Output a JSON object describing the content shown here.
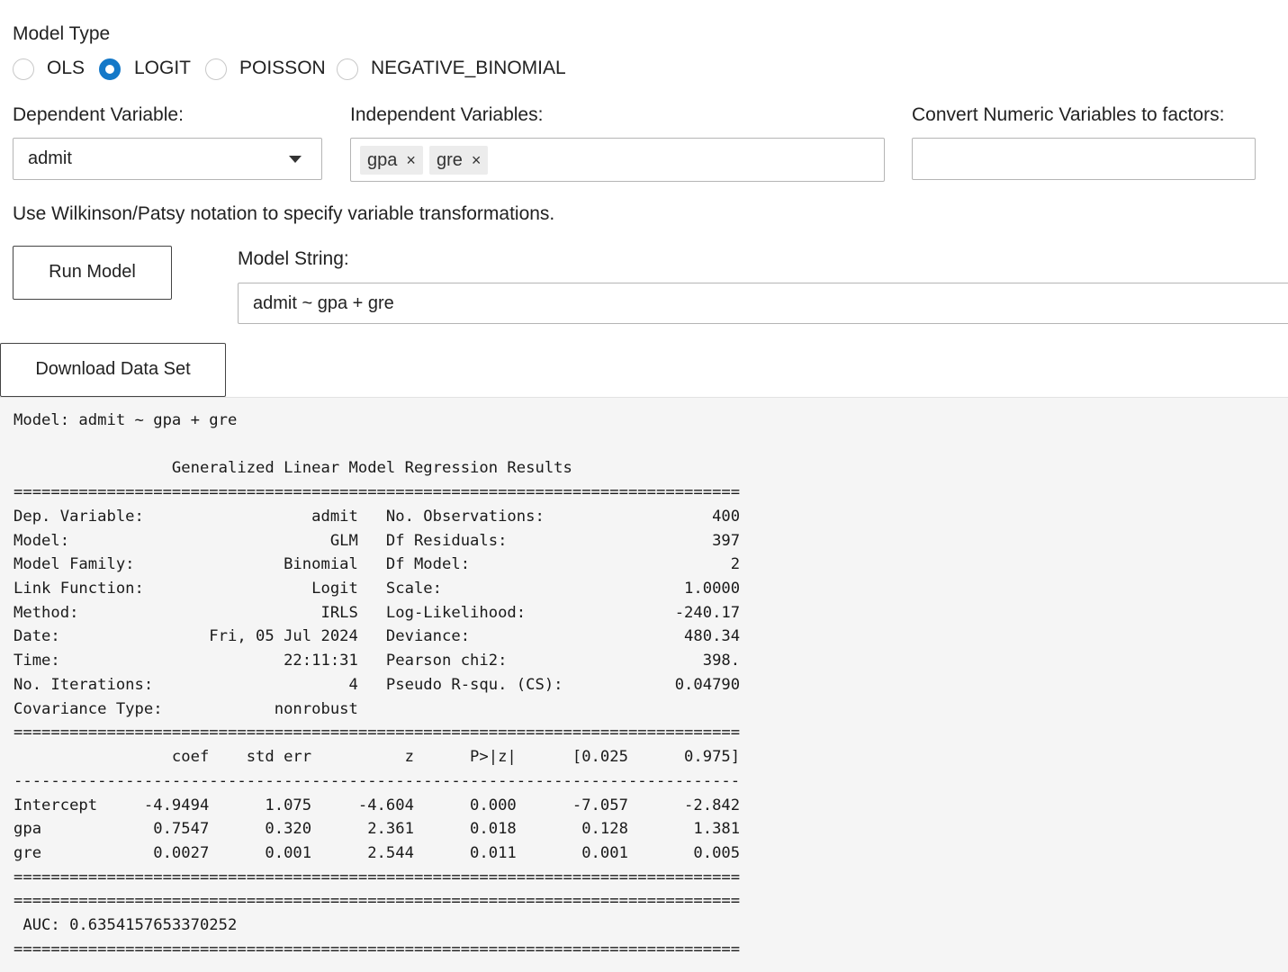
{
  "model_type": {
    "label": "Model Type",
    "options": [
      {
        "label": "OLS",
        "checked": false
      },
      {
        "label": "LOGIT",
        "checked": true
      },
      {
        "label": "POISSON",
        "checked": false
      },
      {
        "label": "NEGATIVE_BINOMIAL",
        "checked": false
      }
    ]
  },
  "dependent": {
    "label": "Dependent Variable:",
    "value": "admit"
  },
  "independent": {
    "label": "Independent Variables:",
    "chips": [
      "gpa",
      "gre"
    ],
    "remove_glyph": "×"
  },
  "convert": {
    "label": "Convert Numeric Variables to factors:",
    "value": ""
  },
  "notation_hint": "Use Wilkinson/Patsy notation to specify variable transformations.",
  "run_button": "Run Model",
  "model_string": {
    "label": "Model String:",
    "value": "admit ~ gpa + gre"
  },
  "download_button": "Download Data Set",
  "output": {
    "lines": [
      "Model: admit ~ gpa + gre",
      "",
      "                 Generalized Linear Model Regression Results",
      "==============================================================================",
      "Dep. Variable:                  admit   No. Observations:                  400",
      "Model:                            GLM   Df Residuals:                      397",
      "Model Family:                Binomial   Df Model:                            2",
      "Link Function:                  Logit   Scale:                          1.0000",
      "Method:                          IRLS   Log-Likelihood:                -240.17",
      "Date:                Fri, 05 Jul 2024   Deviance:                       480.34",
      "Time:                        22:11:31   Pearson chi2:                     398.",
      "No. Iterations:                     4   Pseudo R-squ. (CS):            0.04790",
      "Covariance Type:            nonrobust",
      "==============================================================================",
      "                 coef    std err          z      P>|z|      [0.025      0.975]",
      "------------------------------------------------------------------------------",
      "Intercept     -4.9494      1.075     -4.604      0.000      -7.057      -2.842",
      "gpa            0.7547      0.320      2.361      0.018       0.128       1.381",
      "gre            0.0027      0.001      2.544      0.011       0.001       0.005",
      "==============================================================================",
      "==============================================================================",
      " AUC: 0.6354157653370252",
      "=============================================================================="
    ]
  },
  "colors": {
    "radio_selected": "#1478c8",
    "output_background": "#f5f5f5"
  }
}
